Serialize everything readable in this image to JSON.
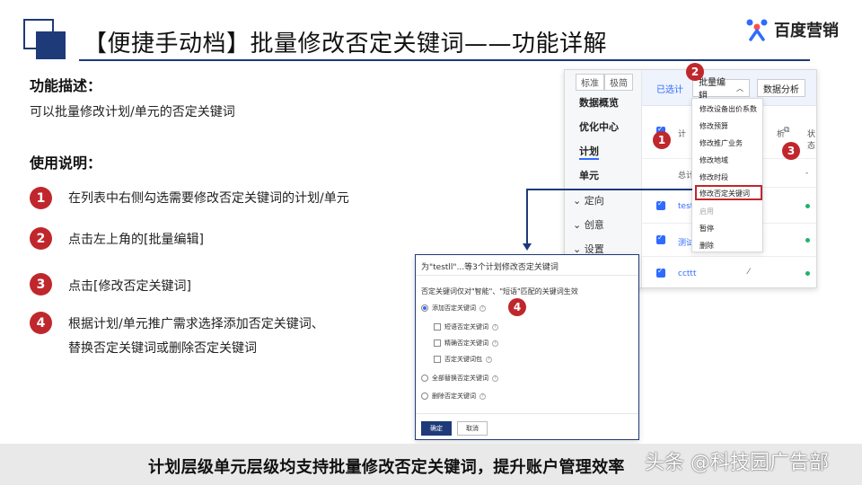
{
  "header": {
    "title": "【便捷手动档】批量修改否定关键词——功能详解",
    "logo_text": "百度营销"
  },
  "description": {
    "heading": "功能描述：",
    "body": "可以批量修改计划/单元的否定关键词"
  },
  "usage": {
    "heading": "使用说明：",
    "steps": [
      {
        "num": "1",
        "text": "在列表中右侧勾选需要修改否定关键词的计划/单元"
      },
      {
        "num": "2",
        "text": "点击左上角的[批量编辑]"
      },
      {
        "num": "3",
        "text": "点击[修改否定关键词]"
      },
      {
        "num": "4",
        "line1": "根据计划/单元推广需求选择添加否定关键词、",
        "line2": "替换否定关键词或删除否定关键词"
      }
    ]
  },
  "screenshot_top": {
    "view_toggle": [
      "标准",
      "极简"
    ],
    "nav": [
      "数据概览",
      "优化中心",
      "计划",
      "单元"
    ],
    "nav_sub": [
      "定向",
      "创意",
      "设置"
    ],
    "selected_label": "已选计",
    "batch_edit_label": "批量编辑",
    "data_analysis_label": "数据分析",
    "col_plan": "计",
    "col_analysis": "析",
    "col_status": "状态",
    "total_label": "总计",
    "dash": "-",
    "rows": [
      "testl",
      "测试",
      "ccttt"
    ],
    "dropdown_items": [
      "修改设备出价系数",
      "修改预算",
      "修改推广业务",
      "修改地域",
      "修改时段",
      "修改否定关键词",
      "启用",
      "暂停",
      "删除"
    ],
    "badges": [
      "1",
      "2",
      "3"
    ]
  },
  "dialog": {
    "title": "为\"testll\"...等3个计划修改否定关键词",
    "note": "否定关键词仅对\"智能\"、\"短语\"匹配的关键词生效",
    "opt_add": "添加否定关键词",
    "sub_options": [
      "短语否定关键词",
      "精确否定关键词",
      "否定关键词包"
    ],
    "opt_replace": "全部替换否定关键词",
    "opt_delete": "删除否定关键词",
    "ok_label": "确定",
    "cancel_label": "取消",
    "badge": "4"
  },
  "banner": {
    "text": "计划层级单元层级均支持批量修改否定关键词，提升账户管理效率",
    "watermark": "头条 @科技园广告部"
  },
  "colors": {
    "navy": "#1e3a78",
    "badge_red": "#c0272d",
    "link_blue": "#2f6bff",
    "banner_gray": "#e9e9ea"
  }
}
